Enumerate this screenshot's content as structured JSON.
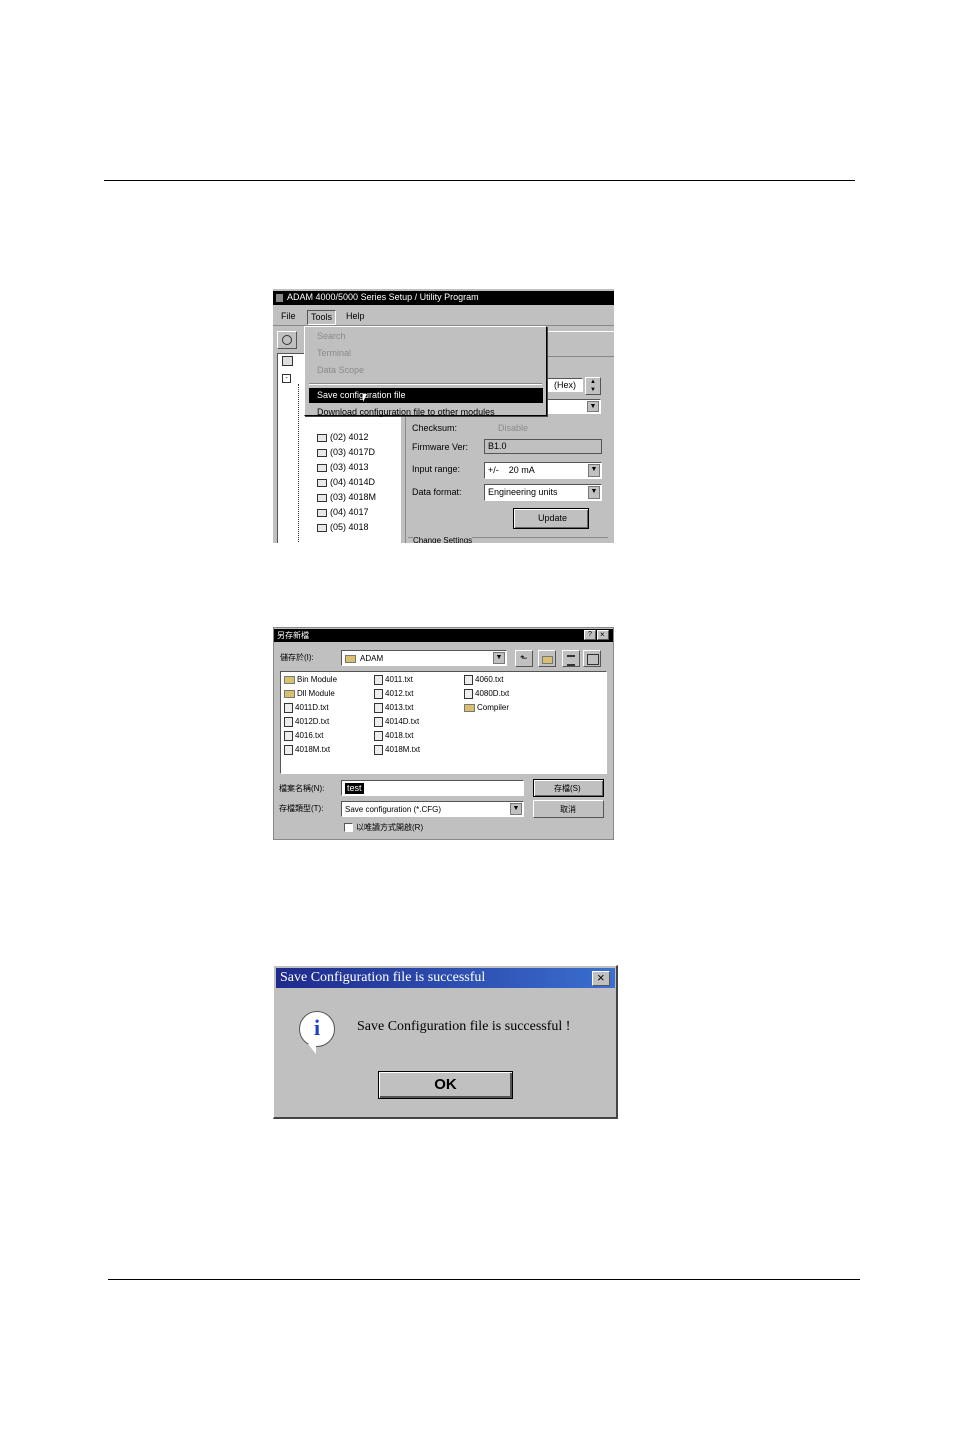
{
  "win1": {
    "title": "ADAM 4000/5000 Series Setup / Utility Program",
    "menu": [
      "File",
      "Tools",
      "Help"
    ],
    "tools_menu": {
      "items": [
        {
          "label": "Search",
          "state": "disabled"
        },
        {
          "label": "Terminal",
          "state": "disabled"
        },
        {
          "label": "Data Scope",
          "state": "disabled"
        },
        {
          "label": "Save configuration file",
          "state": "selected"
        },
        {
          "label": "Download configuration file to other modules",
          "state": "normal"
        }
      ]
    },
    "tree": [
      "(02) 4012",
      "(03) 4017D",
      "(03) 4013",
      "(04) 4014D",
      "(03) 4018M",
      "(04) 4017",
      "(05) 4018"
    ],
    "form": {
      "hex_label": "(Hex)",
      "checksum_label": "Checksum:",
      "checksum_value": "Disable",
      "firmware_label": "Firmware Ver:",
      "firmware_value": "B1.0",
      "input_range_label": "Input range:",
      "input_range_value": "+/-    20 mA",
      "data_format_label": "Data format:",
      "data_format_value": "Engineering units",
      "update_button": "Update",
      "group_label": "Change Settings"
    }
  },
  "win2": {
    "title": "另存新檔",
    "save_in_label": "儲存於(I):",
    "save_in_value": "ADAM",
    "files": [
      [
        "Bin Module",
        "4011.txt",
        "4060.txt"
      ],
      [
        "Dll Module",
        "4012.txt",
        "4080D.txt"
      ],
      [
        "4011D.txt",
        "4013.txt",
        "Compiler"
      ],
      [
        "4012D.txt",
        "4014D.txt",
        ""
      ],
      [
        "4016.txt",
        "4018.txt",
        ""
      ],
      [
        "4018M.txt",
        "4018M.txt",
        ""
      ]
    ],
    "filename_label": "檔案名稱(N):",
    "filename_value": "test",
    "filetype_label": "存檔類型(T):",
    "filetype_value": "Save configuration (*.CFG)",
    "save_button": "存檔(S)",
    "cancel_button": "取消",
    "readonly_label": "以唯讀方式開啟(R)"
  },
  "win3": {
    "title": "Save Configuration file is successful",
    "message": "Save Configuration file is successful !",
    "ok_button": "OK",
    "colors": {
      "titlebar_start": "#1e2a8c",
      "titlebar_end": "#3a6fd0",
      "info_icon": "#1a3fd0"
    }
  }
}
